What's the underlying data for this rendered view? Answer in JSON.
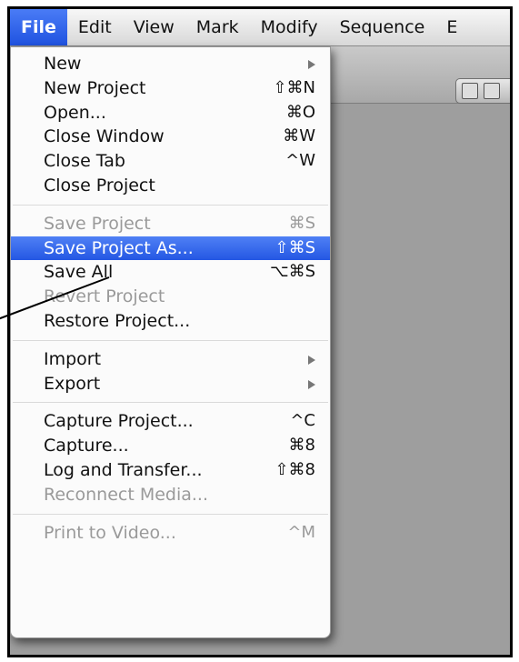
{
  "menubar": {
    "items": [
      "File",
      "Edit",
      "View",
      "Mark",
      "Modify",
      "Sequence",
      "E"
    ],
    "active_index": 0
  },
  "file_menu": {
    "groups": [
      [
        {
          "label": "New",
          "shortcut": "",
          "submenu": true,
          "disabled": false
        },
        {
          "label": "New Project",
          "shortcut": "⇧⌘N",
          "submenu": false,
          "disabled": false
        },
        {
          "label": "Open...",
          "shortcut": "⌘O",
          "submenu": false,
          "disabled": false
        },
        {
          "label": "Close Window",
          "shortcut": "⌘W",
          "submenu": false,
          "disabled": false
        },
        {
          "label": "Close Tab",
          "shortcut": "^W",
          "submenu": false,
          "disabled": false
        },
        {
          "label": "Close Project",
          "shortcut": "",
          "submenu": false,
          "disabled": false
        }
      ],
      [
        {
          "label": "Save Project",
          "shortcut": "⌘S",
          "submenu": false,
          "disabled": true
        },
        {
          "label": "Save Project As...",
          "shortcut": "⇧⌘S",
          "submenu": false,
          "disabled": false,
          "highlighted": true
        },
        {
          "label": "Save All",
          "shortcut": "⌥⌘S",
          "submenu": false,
          "disabled": false
        },
        {
          "label": "Revert Project",
          "shortcut": "",
          "submenu": false,
          "disabled": true
        },
        {
          "label": "Restore Project...",
          "shortcut": "",
          "submenu": false,
          "disabled": false
        }
      ],
      [
        {
          "label": "Import",
          "shortcut": "",
          "submenu": true,
          "disabled": false
        },
        {
          "label": "Export",
          "shortcut": "",
          "submenu": true,
          "disabled": false
        }
      ],
      [
        {
          "label": "Capture Project...",
          "shortcut": "^C",
          "submenu": false,
          "disabled": false
        },
        {
          "label": "Capture...",
          "shortcut": "⌘8",
          "submenu": false,
          "disabled": false
        },
        {
          "label": "Log and Transfer...",
          "shortcut": "⇧⌘8",
          "submenu": false,
          "disabled": false
        },
        {
          "label": "Reconnect Media...",
          "shortcut": "",
          "submenu": false,
          "disabled": true
        }
      ],
      [
        {
          "label": "Print to Video...",
          "shortcut": "^M",
          "submenu": false,
          "disabled": true
        }
      ]
    ]
  },
  "colors": {
    "highlight": "#2f63ea",
    "disabled_text": "#9a9a9a",
    "menu_bg": "#fbfbfb"
  }
}
